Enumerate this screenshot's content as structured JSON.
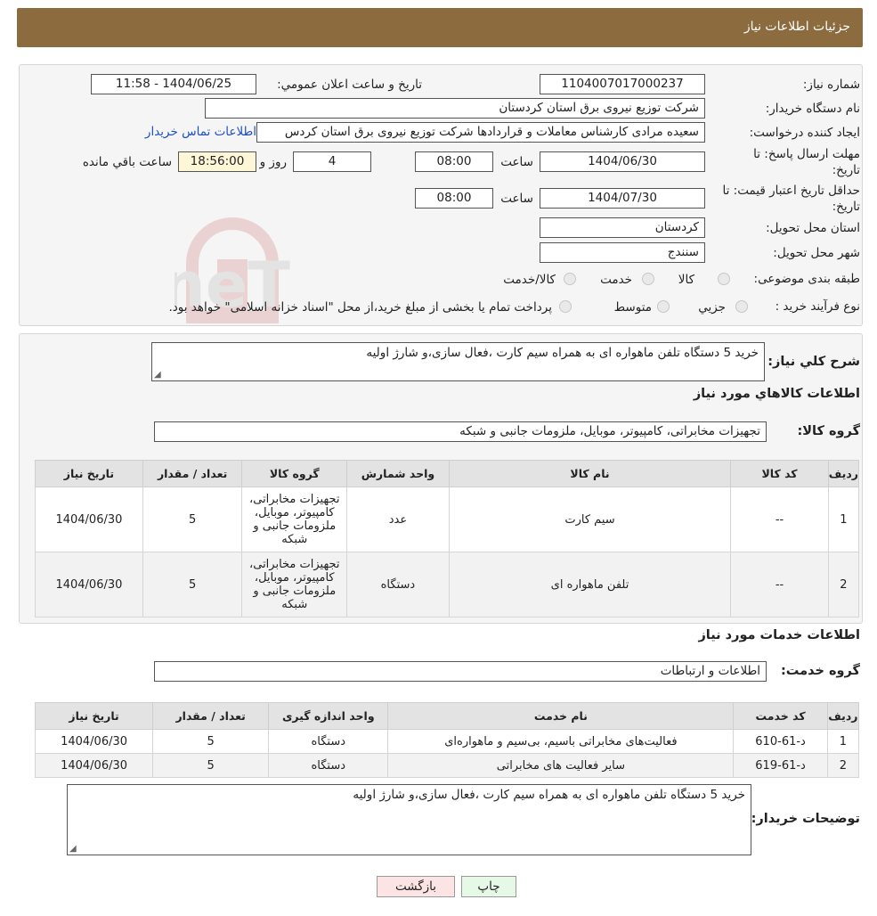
{
  "header": {
    "title": "جزئیات اطلاعات نیاز"
  },
  "watermark": {
    "text": "AriaTender.neT"
  },
  "info": {
    "need_number_label": "شماره نیاز:",
    "need_number": "1104007017000237",
    "announce_label": "تاریخ و ساعت اعلان عمومي:",
    "announce_value": "1404/06/25 - 11:58",
    "buyer_org_label": "نام دستگاه خریدار:",
    "buyer_org": "شرکت توزیع نیروی برق استان کردستان",
    "requester_label": "ایجاد کننده درخواست:",
    "requester": "سعیده مرادی کارشناس معاملات و قراردادها شرکت توزیع نیروی برق استان کردس",
    "contact_link": "اطلاعات تماس خریدار",
    "deadline_label_1": "مهلت ارسال پاسخ: تا",
    "deadline_label_2": "تاریخ:",
    "deadline_date": "1404/06/30",
    "time_label": "ساعت",
    "deadline_time": "08:00",
    "days_value": "4",
    "days_label": "روز و",
    "remaining_time": "18:56:00",
    "remaining_label": "ساعت باقي مانده",
    "validity_label_1": "حداقل تاریخ اعتبار قیمت: تا",
    "validity_label_2": "تاریخ:",
    "validity_date": "1404/07/30",
    "validity_time": "08:00",
    "province_label": "استان محل تحویل:",
    "province": "کردستان",
    "city_label": "شهر محل تحویل:",
    "city": "سنندج",
    "category_label": "طبقه بندی موضوعی:",
    "category_options": [
      "کالا",
      "خدمت",
      "کالا/خدمت"
    ],
    "process_label": "نوع فرآیند خرید :",
    "process_options": [
      "جزيي",
      "متوسط"
    ],
    "process_note": "پرداخت تمام یا بخشی از مبلغ خرید،از محل \"اسناد خزانه اسلامی\" خواهد بود."
  },
  "goods": {
    "summary_label": "شرح کلي نیاز:",
    "summary": "خرید 5 دستگاه تلفن ماهواره ای به همراه سیم کارت ،فعال سازی،و شارژ اولیه",
    "section_title": "اطلاعات کالاهاي مورد نياز",
    "group_label": "گروه کالا:",
    "group_value": "تجهیزات مخابراتی، کامپیوتر، موبایل، ملزومات جانبی و شبکه",
    "columns": [
      "ردیف",
      "کد کالا",
      "نام کالا",
      "واحد شمارش",
      "گروه کالا",
      "تعداد / مقدار",
      "تاریخ نیاز"
    ],
    "rows": [
      {
        "row": "1",
        "code": "--",
        "name": "سیم کارت",
        "unit": "عدد",
        "group": "تجهیزات مخابراتی، کامپیوتر، موبایل، ملزومات جانبی و شبکه",
        "qty": "5",
        "date": "1404/06/30"
      },
      {
        "row": "2",
        "code": "--",
        "name": "تلفن ماهواره ای",
        "unit": "دستگاه",
        "group": "تجهیزات مخابراتی، کامپیوتر، موبایل، ملزومات جانبی و شبکه",
        "qty": "5",
        "date": "1404/06/30"
      }
    ]
  },
  "services": {
    "section_title": "اطلاعات خدمات مورد نياز",
    "group_label": "گروه خدمت:",
    "group_value": "اطلاعات و ارتباطات",
    "columns": [
      "ردیف",
      "کد خدمت",
      "نام خدمت",
      "واحد اندازه گیری",
      "تعداد / مقدار",
      "تاریخ نیاز"
    ],
    "rows": [
      {
        "row": "1",
        "code": "د-61-610",
        "name": "فعالیت‌های مخابراتی باسیم، بی‌سیم و ماهواره‌ای",
        "unit": "دستگاه",
        "qty": "5",
        "date": "1404/06/30"
      },
      {
        "row": "2",
        "code": "د-61-619",
        "name": "سایر فعالیت های مخابراتی",
        "unit": "دستگاه",
        "qty": "5",
        "date": "1404/06/30"
      }
    ]
  },
  "buyer_notes": {
    "label": "توضیحات خریدار:",
    "text": "خرید 5 دستگاه تلفن ماهواره ای به همراه سیم کارت ،فعال سازی،و شارژ اولیه"
  },
  "buttons": {
    "print": "چاپ",
    "back": "بازگشت"
  }
}
